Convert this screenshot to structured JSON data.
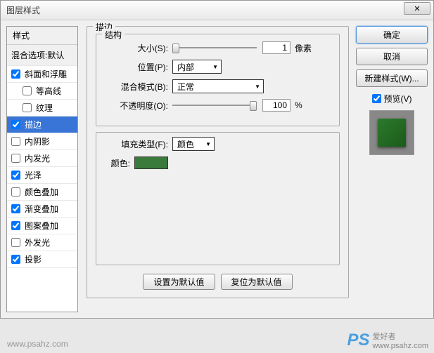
{
  "dialog": {
    "title": "图层样式",
    "close": "✕"
  },
  "styles": {
    "header": "样式",
    "blend": "混合选项:默认",
    "items": [
      {
        "label": "斜面和浮雕",
        "checked": true
      },
      {
        "label": "等高线",
        "checked": false,
        "indent": true
      },
      {
        "label": "纹理",
        "checked": false,
        "indent": true
      },
      {
        "label": "描边",
        "checked": true,
        "selected": true
      },
      {
        "label": "内阴影",
        "checked": false
      },
      {
        "label": "内发光",
        "checked": false
      },
      {
        "label": "光泽",
        "checked": true
      },
      {
        "label": "颜色叠加",
        "checked": false
      },
      {
        "label": "渐变叠加",
        "checked": true
      },
      {
        "label": "图案叠加",
        "checked": true
      },
      {
        "label": "外发光",
        "checked": false
      },
      {
        "label": "投影",
        "checked": true
      }
    ]
  },
  "stroke": {
    "title": "描边",
    "structure": "结构",
    "size_label": "大小(S):",
    "size_value": "1",
    "size_unit": "像素",
    "position_label": "位置(P):",
    "position_value": "内部",
    "blend_label": "混合模式(B):",
    "blend_value": "正常",
    "opacity_label": "不透明度(O):",
    "opacity_value": "100",
    "opacity_unit": "%",
    "filltype_label": "填充类型(F):",
    "filltype_value": "颜色",
    "color_label": "颜色:",
    "color_value": "#3a7a3a",
    "default_btn": "设置为默认值",
    "reset_btn": "复位为默认值"
  },
  "actions": {
    "ok": "确定",
    "cancel": "取消",
    "new_style": "新建样式(W)...",
    "preview_label": "预览(V)"
  },
  "watermark": {
    "logo": "PS",
    "text": "爱好者",
    "url": "www.psahz.com"
  }
}
